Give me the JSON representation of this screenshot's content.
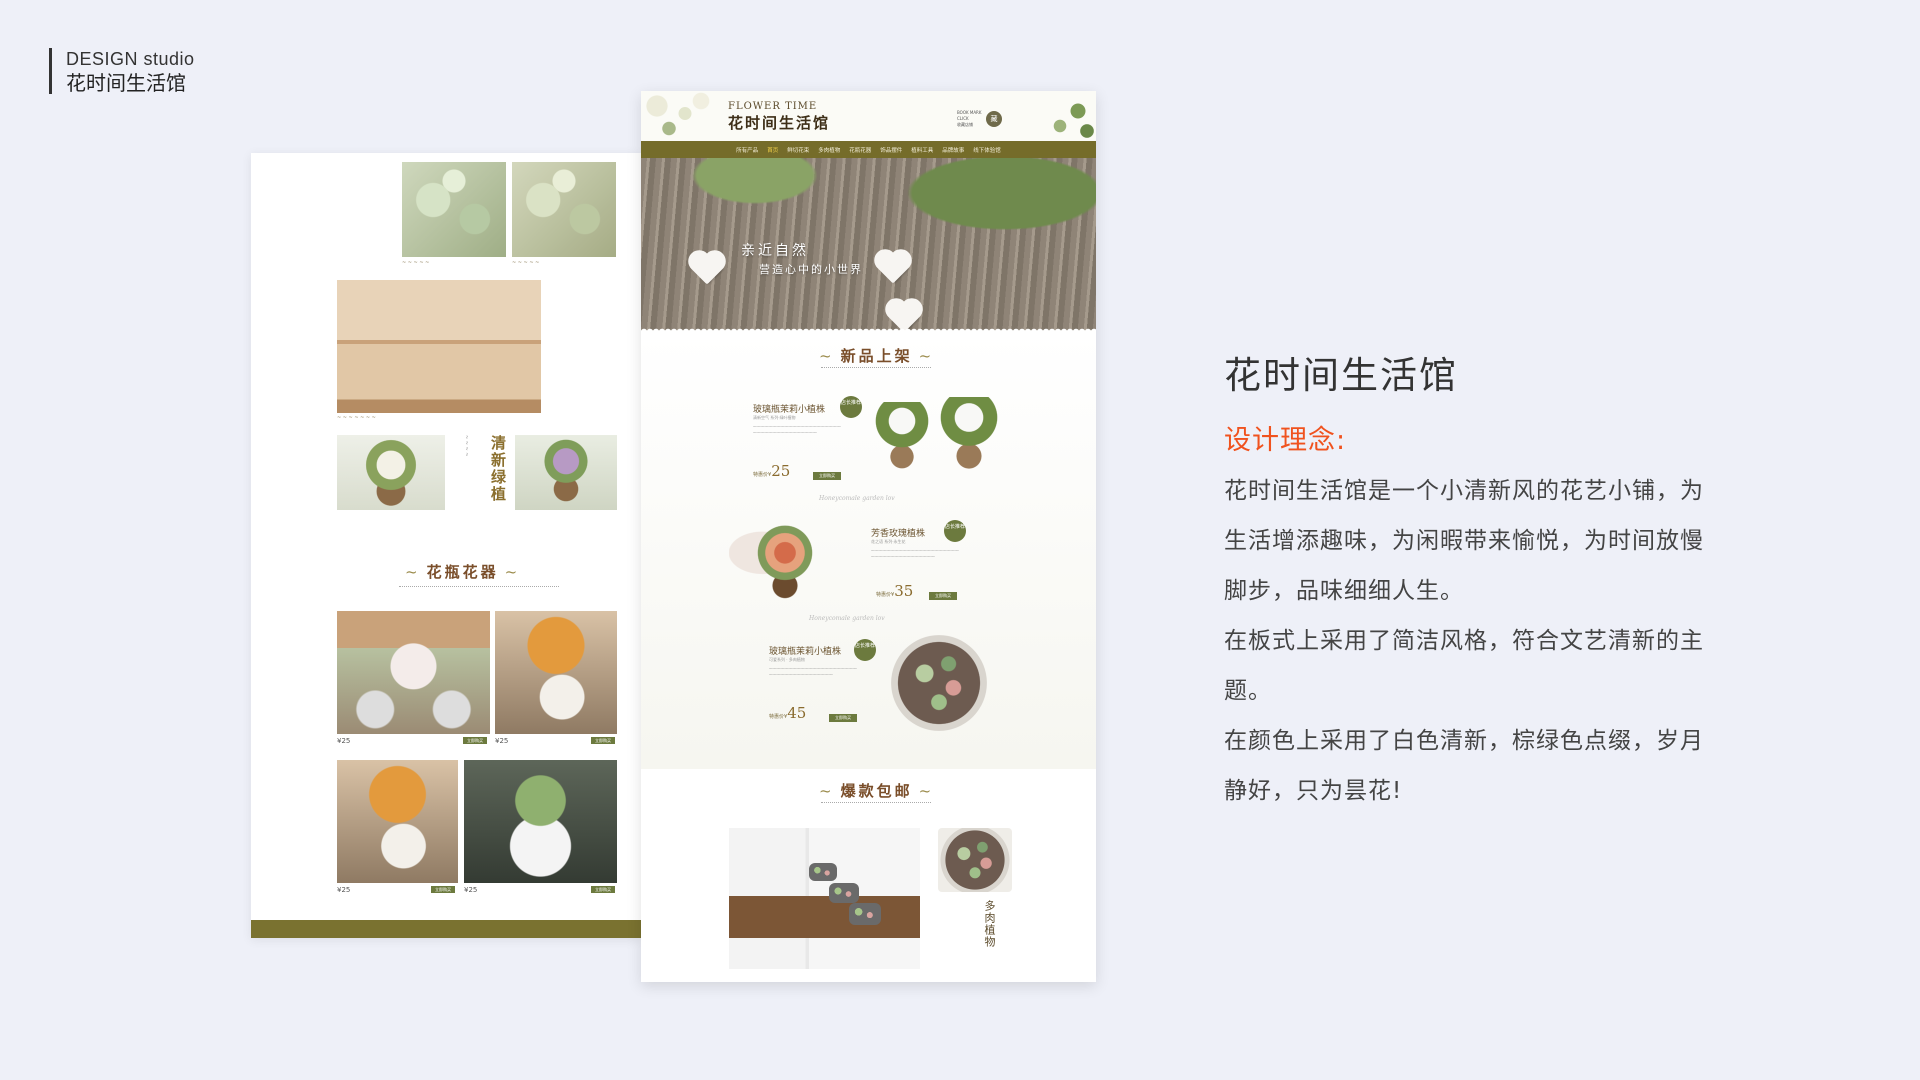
{
  "brand": {
    "en": "DESIGN studio",
    "cn": "花时间生活馆"
  },
  "info": {
    "title": "花时间生活馆",
    "concept_label": "设计理念:",
    "paragraphs": [
      "花时间生活馆是一个小清新风的花艺小铺，为生活增添趣味，为闲暇带来愉悦，为时间放慢脚步，品味细细人生。",
      "在板式上采用了简洁风格，符合文艺清新的主题。",
      "在颜色上采用了白色清新，棕绿色点缀，岁月静好，只为昙花!"
    ]
  },
  "mockup_right": {
    "logo_en": "FLOWER TIME",
    "logo_cn": "花时间生活馆",
    "bookmark_lines": [
      "BOOK MARK",
      "CLICK",
      "收藏店铺"
    ],
    "collect_icon": "藏",
    "nav": [
      "所有产品",
      "首页",
      "鲜切花束",
      "多肉植物",
      "花瓶花器",
      "饰品摆件",
      "植料工具",
      "品牌故事",
      "线下体验馆"
    ],
    "nav_active_index": 1,
    "banner": {
      "line1": "亲近自然",
      "line2": "营造心中的小世界"
    },
    "new_section_title": "新品上架",
    "products": [
      {
        "name": "玻璃瓶茉莉小植株",
        "tag": "清新空气 系列·绿叶植物",
        "badge": "店长推荐",
        "price_label": "特惠价¥",
        "price": "25",
        "buy": "立即购买"
      },
      {
        "name": "芳香玫瑰植株",
        "tag": "花之语 系列·永生花",
        "badge": "店长推荐",
        "price_label": "特惠价¥",
        "price": "35",
        "buy": "立即购买"
      },
      {
        "name": "玻璃瓶茉莉小植株",
        "tag": "可爱系列 · 多肉植物",
        "badge": "店长推荐",
        "price_label": "特惠价¥",
        "price": "45",
        "buy": "立即购买"
      }
    ],
    "script_text": "Honeycomale garden lov",
    "hot_section_title": "爆款包邮",
    "succulent_label": "多肉植物"
  },
  "mockup_left": {
    "section_vertical_title": "清新绿植",
    "vase_section_title": "花瓶花器",
    "items": [
      {
        "price": "¥25",
        "buy": "立即购买"
      },
      {
        "price": "¥25",
        "buy": "立即购买"
      },
      {
        "price": "¥25",
        "buy": "立即购买"
      },
      {
        "price": "¥25",
        "buy": "立即购买"
      }
    ]
  }
}
